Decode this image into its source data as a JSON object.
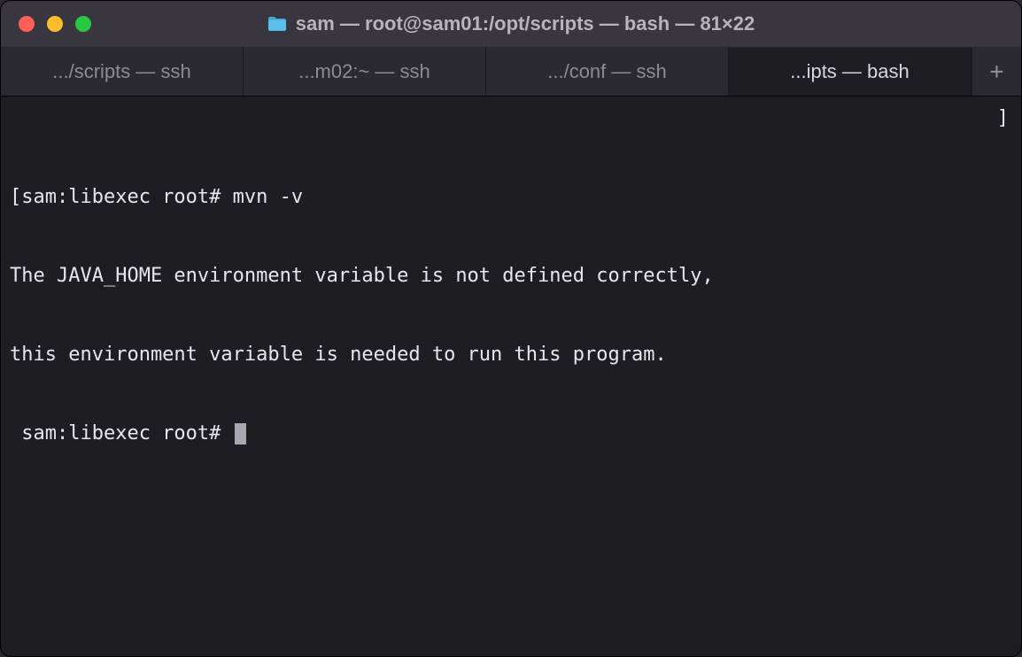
{
  "titlebar": {
    "title": "sam — root@sam01:/opt/scripts — bash — 81×22"
  },
  "tabs": [
    {
      "label": ".../scripts — ssh",
      "active": false
    },
    {
      "label": "...m02:~ — ssh",
      "active": false
    },
    {
      "label": ".../conf — ssh",
      "active": false
    },
    {
      "label": "...ipts — bash",
      "active": true
    }
  ],
  "new_tab_label": "+",
  "terminal": {
    "lines": [
      "[sam:libexec root# mvn -v",
      "The JAVA_HOME environment variable is not defined correctly,",
      "this environment variable is needed to run this program.",
      " sam:libexec root# "
    ],
    "right_bracket": "]"
  }
}
